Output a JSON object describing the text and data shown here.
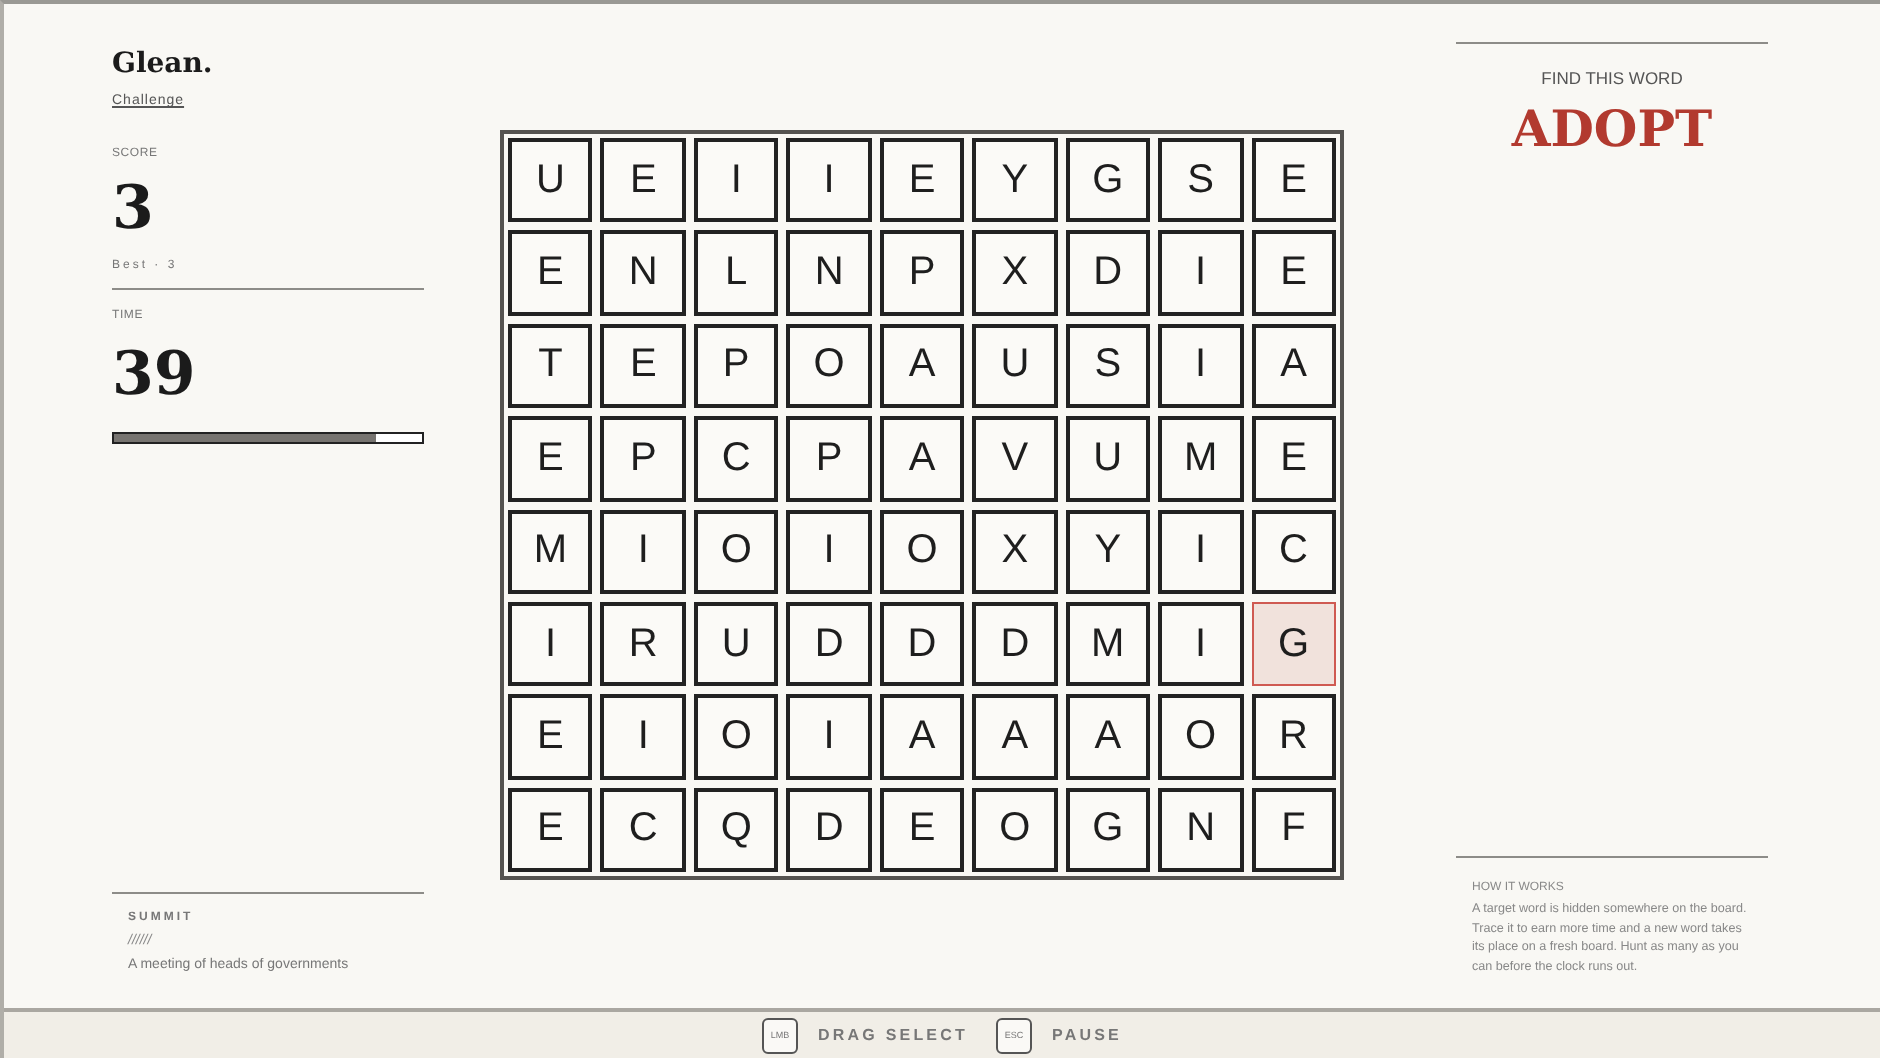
{
  "brand": {
    "title": "Glean.",
    "mode": "Challenge"
  },
  "score": {
    "label": "SCORE",
    "value": "3",
    "best": "Best · 3"
  },
  "timer": {
    "label": "TIME",
    "value": "39",
    "level": 0.85
  },
  "clue": {
    "category": "SUMMIT",
    "masked": "//////",
    "definition": "A meeting of heads of governments"
  },
  "target": {
    "label": "FIND THIS WORD",
    "word": "ADOPT"
  },
  "help": {
    "title": "HOW IT WORKS",
    "text": "A target word is hidden somewhere on the board. Trace it to earn more time and a new word takes its place on a fresh board. Hunt as many as you can before the clock runs out."
  },
  "grid": [
    [
      {
        "letter": "U",
        "selected": false
      },
      {
        "letter": "E",
        "selected": false
      },
      {
        "letter": "I",
        "selected": false
      },
      {
        "letter": "I",
        "selected": false
      },
      {
        "letter": "E",
        "selected": false
      },
      {
        "letter": "Y",
        "selected": false
      },
      {
        "letter": "G",
        "selected": false
      },
      {
        "letter": "S",
        "selected": false
      },
      {
        "letter": "E",
        "selected": false
      }
    ],
    [
      {
        "letter": "E",
        "selected": false
      },
      {
        "letter": "N",
        "selected": false
      },
      {
        "letter": "L",
        "selected": false
      },
      {
        "letter": "N",
        "selected": false
      },
      {
        "letter": "P",
        "selected": false
      },
      {
        "letter": "X",
        "selected": false
      },
      {
        "letter": "D",
        "selected": false
      },
      {
        "letter": "I",
        "selected": false
      },
      {
        "letter": "E",
        "selected": false
      }
    ],
    [
      {
        "letter": "T",
        "selected": false
      },
      {
        "letter": "E",
        "selected": false
      },
      {
        "letter": "P",
        "selected": false
      },
      {
        "letter": "O",
        "selected": false
      },
      {
        "letter": "A",
        "selected": false
      },
      {
        "letter": "U",
        "selected": false
      },
      {
        "letter": "S",
        "selected": false
      },
      {
        "letter": "I",
        "selected": false
      },
      {
        "letter": "A",
        "selected": false
      }
    ],
    [
      {
        "letter": "E",
        "selected": false
      },
      {
        "letter": "P",
        "selected": false
      },
      {
        "letter": "C",
        "selected": false
      },
      {
        "letter": "P",
        "selected": false
      },
      {
        "letter": "A",
        "selected": false
      },
      {
        "letter": "V",
        "selected": false
      },
      {
        "letter": "U",
        "selected": false
      },
      {
        "letter": "M",
        "selected": false
      },
      {
        "letter": "E",
        "selected": false
      }
    ],
    [
      {
        "letter": "M",
        "selected": false
      },
      {
        "letter": "I",
        "selected": false
      },
      {
        "letter": "O",
        "selected": false
      },
      {
        "letter": "I",
        "selected": false
      },
      {
        "letter": "O",
        "selected": false
      },
      {
        "letter": "X",
        "selected": false
      },
      {
        "letter": "Y",
        "selected": false
      },
      {
        "letter": "I",
        "selected": false
      },
      {
        "letter": "C",
        "selected": false
      }
    ],
    [
      {
        "letter": "I",
        "selected": false
      },
      {
        "letter": "R",
        "selected": false
      },
      {
        "letter": "U",
        "selected": false
      },
      {
        "letter": "D",
        "selected": false
      },
      {
        "letter": "D",
        "selected": false
      },
      {
        "letter": "D",
        "selected": false
      },
      {
        "letter": "M",
        "selected": false
      },
      {
        "letter": "I",
        "selected": false
      },
      {
        "letter": "G",
        "selected": true
      }
    ],
    [
      {
        "letter": "E",
        "selected": false
      },
      {
        "letter": "I",
        "selected": false
      },
      {
        "letter": "O",
        "selected": false
      },
      {
        "letter": "I",
        "selected": false
      },
      {
        "letter": "A",
        "selected": false
      },
      {
        "letter": "A",
        "selected": false
      },
      {
        "letter": "A",
        "selected": false
      },
      {
        "letter": "O",
        "selected": false
      },
      {
        "letter": "R",
        "selected": false
      }
    ],
    [
      {
        "letter": "E",
        "selected": false
      },
      {
        "letter": "C",
        "selected": false
      },
      {
        "letter": "Q",
        "selected": false
      },
      {
        "letter": "D",
        "selected": false
      },
      {
        "letter": "E",
        "selected": false
      },
      {
        "letter": "O",
        "selected": false
      },
      {
        "letter": "G",
        "selected": false
      },
      {
        "letter": "N",
        "selected": false
      },
      {
        "letter": "F",
        "selected": false
      }
    ]
  ],
  "controls": [
    {
      "key": "LMB",
      "action": "DRAG SELECT"
    },
    {
      "key": "ESC",
      "action": "PAUSE"
    }
  ]
}
